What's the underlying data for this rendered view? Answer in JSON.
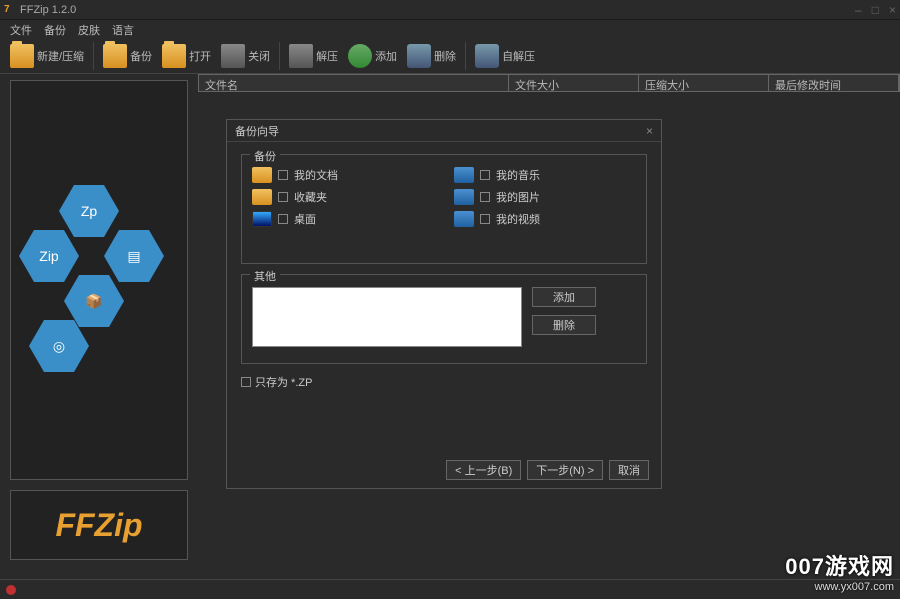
{
  "app": {
    "title": "FFZip 1.2.0",
    "icon_glyph": "7"
  },
  "window_controls": {
    "min": "–",
    "max": "□",
    "close": "×"
  },
  "menu": [
    "文件",
    "备份",
    "皮肤",
    "语言"
  ],
  "toolbar": [
    {
      "key": "new",
      "label": "新建/压缩"
    },
    {
      "key": "backup",
      "label": "备份"
    },
    {
      "key": "open",
      "label": "打开"
    },
    {
      "key": "close",
      "label": "关闭"
    },
    {
      "key": "extract",
      "label": "解压"
    },
    {
      "key": "add",
      "label": "添加"
    },
    {
      "key": "delete",
      "label": "删除"
    },
    {
      "key": "sfx",
      "label": "自解压"
    }
  ],
  "columns": {
    "name": "文件名",
    "size": "文件大小",
    "packed": "压缩大小",
    "modified": "最后修改时间"
  },
  "brand": "FFZip",
  "dialog": {
    "title": "备份向导",
    "group_backup": "备份",
    "sources": [
      {
        "label": "我的文档",
        "icon": "yel"
      },
      {
        "label": "我的音乐",
        "icon": "blue"
      },
      {
        "label": "收藏夹",
        "icon": "yel"
      },
      {
        "label": "我的图片",
        "icon": "blue"
      },
      {
        "label": "桌面",
        "icon": "mon"
      },
      {
        "label": "我的视频",
        "icon": "blue"
      }
    ],
    "group_other": "其他",
    "add": "添加",
    "remove": "删除",
    "save_as_checkbox": "只存为 *.ZP",
    "prev": "< 上一步(B)",
    "next": "下一步(N) >",
    "cancel": "取消"
  },
  "watermark": {
    "line1": "007游戏网",
    "line2": "www.yx007.com"
  }
}
